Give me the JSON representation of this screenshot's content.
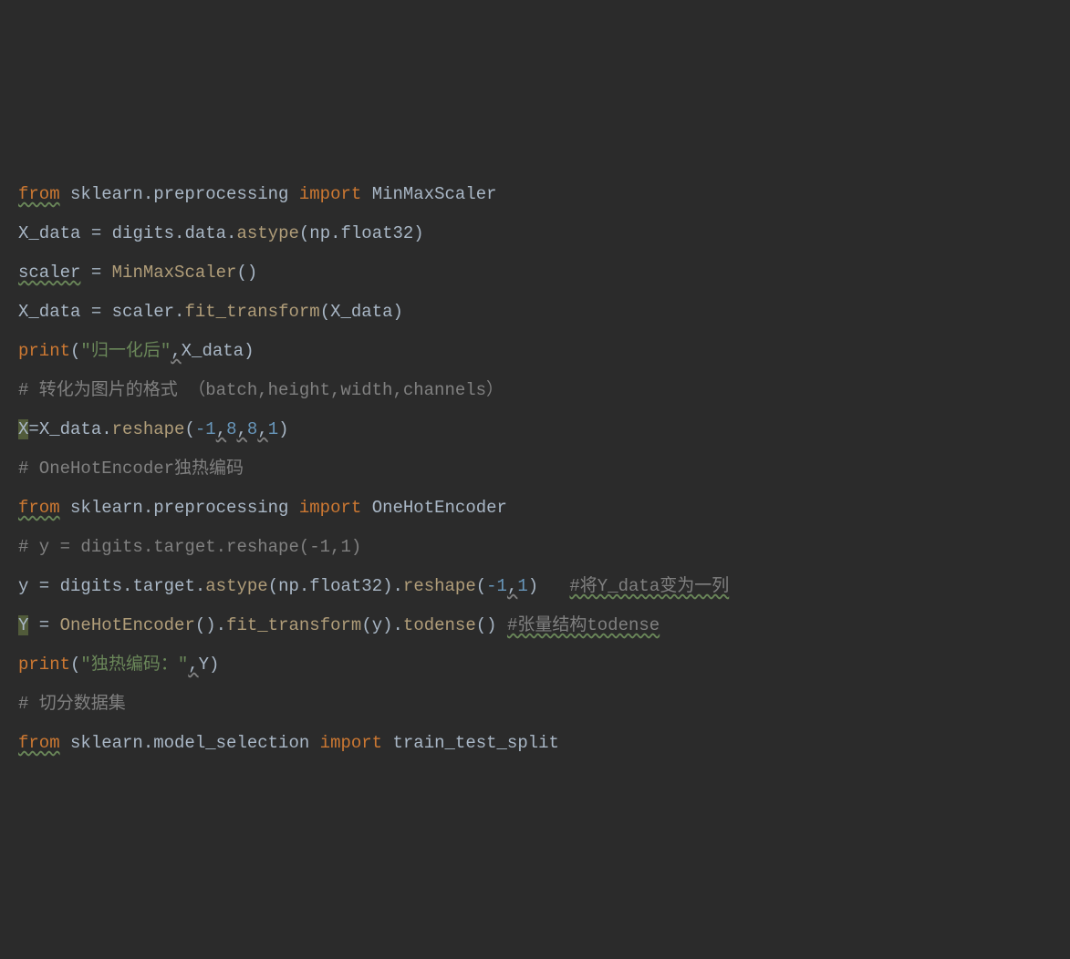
{
  "code": {
    "l1": {
      "from": "from",
      "mod": "sklearn.preprocessing",
      "imp": "import",
      "cls": "MinMaxScaler"
    },
    "l2": {
      "lhs": "X_data",
      "eq": " = ",
      "rhs1": "digits.data.",
      "fn": "astype",
      "args": "(np.float32)"
    },
    "l3": {
      "lhs": "scaler",
      "eq": " = ",
      "fn": "MinMaxScaler",
      "args": "()"
    },
    "l4": {
      "lhs": "X_data",
      "eq": " = ",
      "obj": "scaler.",
      "fn": "fit_transform",
      "args": "(X_data)"
    },
    "l5": {
      "fn": "print",
      "op": "(",
      "str": "\"归一化后\"",
      "comma": ",",
      "arg": "X_data",
      "cp": ")"
    },
    "l6": {
      "cmt": "# 转化为图片的格式 （batch,height,width,channels）"
    },
    "l7": {
      "lhs": "X",
      "eq": "=",
      "obj": "X_data.",
      "fn": "reshape",
      "op": "(",
      "n1": "-1",
      "c1": ",",
      "n2": "8",
      "c2": ",",
      "n3": "8",
      "c3": ",",
      "n4": "1",
      "cp": ")"
    },
    "l8": {
      "cmt": "# OneHotEncoder独热编码"
    },
    "l9": {
      "from": "from",
      "mod": "sklearn.preprocessing",
      "imp": "import",
      "cls": "OneHotEncoder"
    },
    "l10": {
      "cmt": "# y = digits.target.reshape(-1,1)"
    },
    "l11": {
      "lhs": "y",
      "eq": " = ",
      "obj": "digits.target.",
      "fn1": "astype",
      "a1": "(np.float32).",
      "fn2": "reshape",
      "op": "(",
      "n1": "-1",
      "c": ",",
      "n2": "1",
      "cp": ")",
      "sp": "   ",
      "cmt": "#将Y_data变为一列"
    },
    "l12": {
      "lhs": "Y",
      "eq": " = ",
      "fn1": "OneHotEncoder",
      "a1": "().",
      "fn2": "fit_transform",
      "a2": "(y).",
      "fn3": "todense",
      "a3": "()",
      "sp": " ",
      "cmt": "#张量结构todense"
    },
    "l13": {
      "fn": "print",
      "op": "(",
      "str": "\"独热编码：\"",
      "comma": ",",
      "arg": "Y",
      "cp": ")"
    },
    "l14": {
      "cmt": "# 切分数据集"
    },
    "l15": {
      "from": "from",
      "mod": "sklearn.model_selection",
      "imp": "import",
      "cls": "train_test_split"
    }
  }
}
